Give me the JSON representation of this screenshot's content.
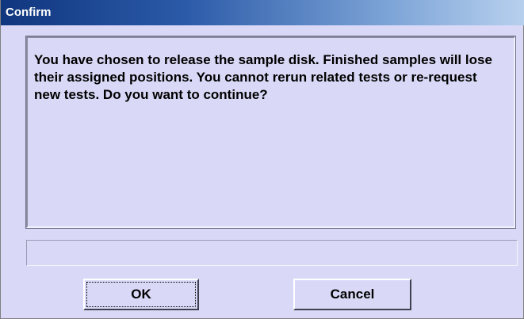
{
  "window": {
    "title": "Confirm"
  },
  "message": "You have chosen to release the sample disk. Finished samples will lose their assigned positions. You cannot rerun related tests or re-request new tests. Do you want to continue?",
  "status_field": {
    "value": ""
  },
  "buttons": {
    "ok_label": "OK",
    "cancel_label": "Cancel"
  },
  "colors": {
    "dialog_background": "#d9d9f7",
    "titlebar_start": "#10367e",
    "titlebar_end": "#b8d0ee"
  }
}
